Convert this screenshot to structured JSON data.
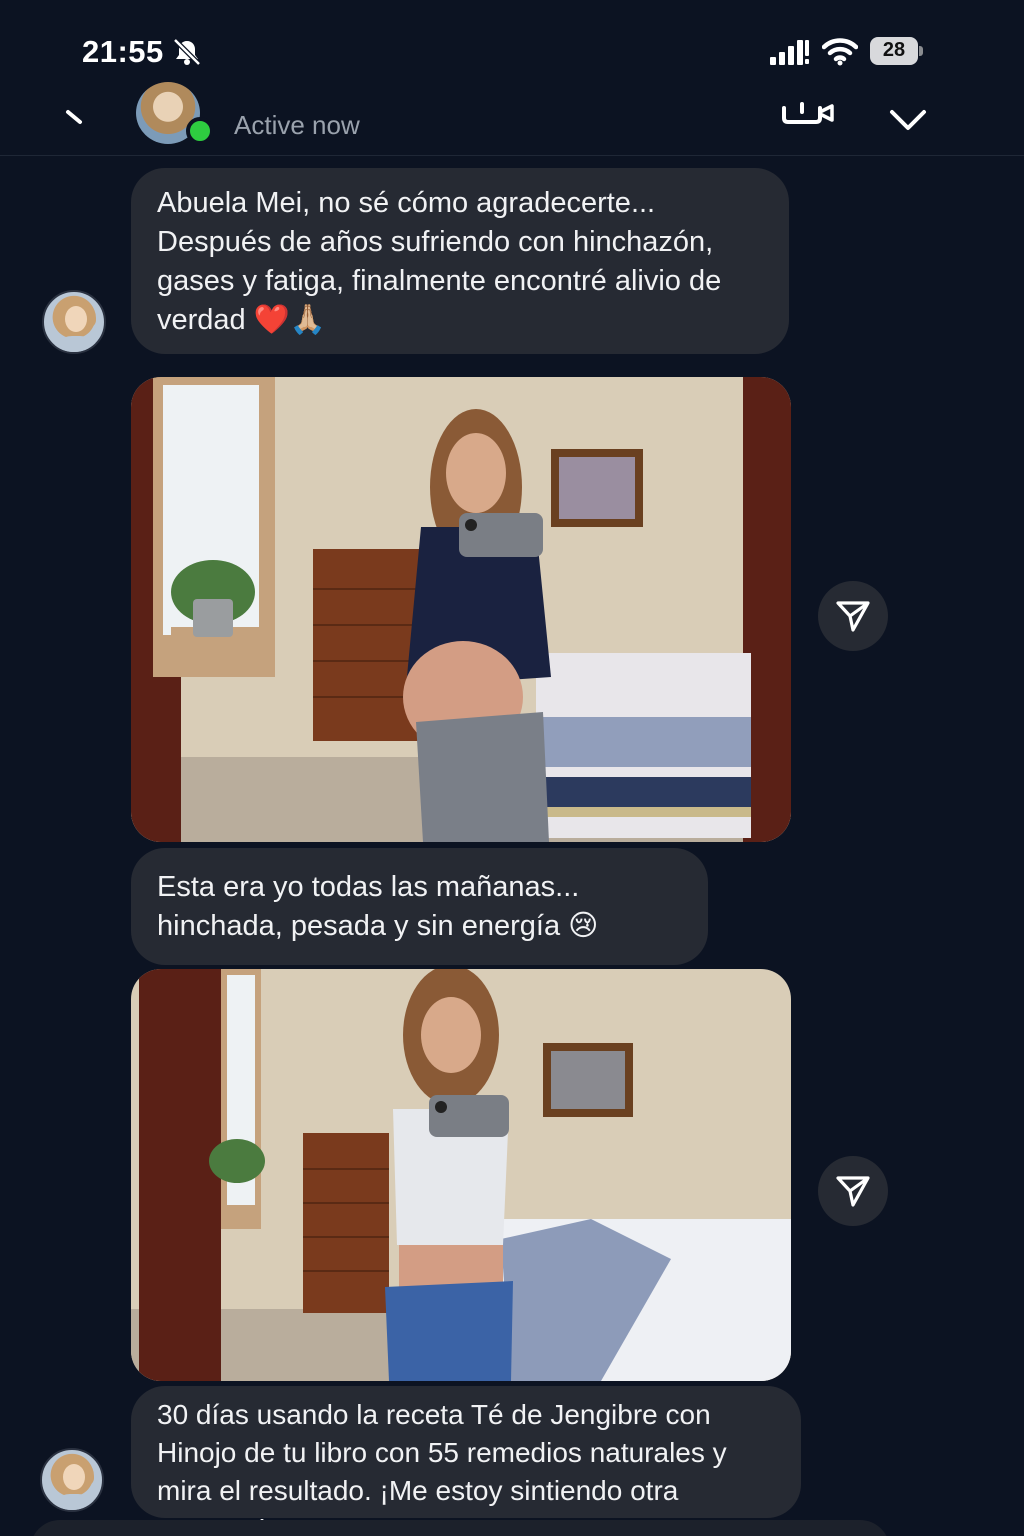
{
  "status_bar": {
    "time": "21:55",
    "battery": "28",
    "icons": [
      "bell-off-icon",
      "signal-icon",
      "wifi-icon",
      "battery-icon"
    ]
  },
  "header": {
    "status": "Active now",
    "icons": [
      "back-icon",
      "video-call-icon",
      "chevron-down-icon"
    ],
    "online_color": "#2ecc40"
  },
  "messages": [
    {
      "type": "text",
      "lines": [
        "Abuela Mei, no sé cómo agradecerte...",
        "Después de años sufriendo con hinchazón,",
        "gases y fatiga, finalmente encontré alivio de",
        "verdad ❤️🙏🏼"
      ]
    },
    {
      "type": "image",
      "subject": "before-photo"
    },
    {
      "type": "text",
      "lines": [
        "Esta era yo todas las mañanas...",
        "hinchada, pesada y sin energía 😢"
      ]
    },
    {
      "type": "image",
      "subject": "after-photo"
    },
    {
      "type": "text",
      "lines": [
        "30 días usando la receta Té de Jengibre con",
        "Hinojo de tu libro con 55 remedios naturales y",
        "mira el resultado. ¡Me estoy sintiendo otra persona!"
      ]
    }
  ],
  "colors": {
    "background": "#0c1322",
    "bubble": "#262a33",
    "text": "#f1f2f4",
    "secondary_text": "#9aa2ad"
  }
}
